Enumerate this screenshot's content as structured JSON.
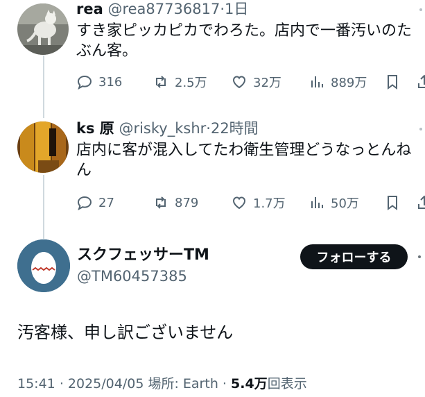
{
  "replies": [
    {
      "name": "rea",
      "handle": "@rea87736817",
      "time": "1日",
      "text": "すき家ピッカピカでわろた。店内で一番汚いのたぶん客。",
      "replies": "316",
      "retweets": "2.5万",
      "likes": "32万",
      "views": "889万",
      "avatar_icon": "cat-photo-avatar"
    },
    {
      "name": "ks 原",
      "handle": "@risky_kshr",
      "time": "22時間",
      "text": "店内に客が混入してたわ衛生管理どうなっとんねん",
      "replies": "27",
      "retweets": "879",
      "likes": "1.7万",
      "views": "50万",
      "avatar_icon": "doorway-photo-avatar"
    }
  ],
  "main": {
    "name": "スクフェッサーTM",
    "handle": "@TM60457385",
    "follow_label": "フォローする",
    "text": "汚客様、申し訳ございません",
    "time": "15:41",
    "date": "2025/04/05",
    "location": "場所: Earth",
    "views_count": "5.4万",
    "views_label": "回表示",
    "separator": "·",
    "avatar_icon": "egg-avatar"
  },
  "colors": {
    "text": "#0f1419",
    "secondary": "#536471",
    "thread_line": "#cfd9de",
    "follow_bg": "#0f1419",
    "egg_bg": "#3f6f8f"
  }
}
